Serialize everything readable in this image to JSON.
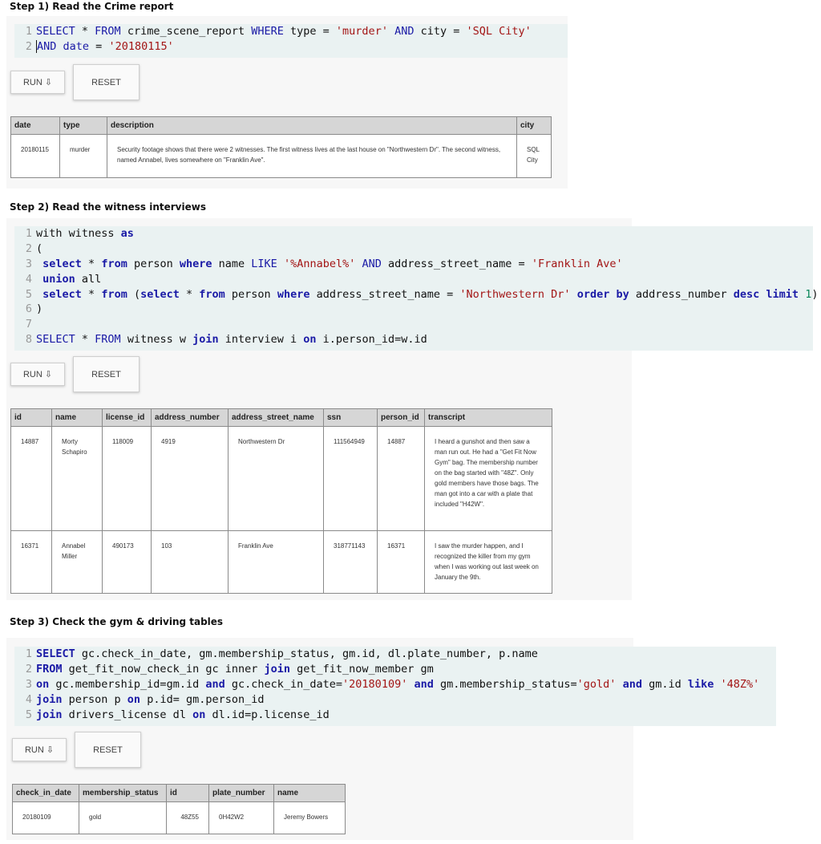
{
  "step1": {
    "title": "Step 1) Read the Crime report",
    "run_label": "RUN ⇩",
    "reset_label": "RESET",
    "columns": [
      "date",
      "type",
      "description",
      "city"
    ],
    "rows": [
      [
        "20180115",
        "murder",
        "Security footage shows that there were 2 witnesses. The first witness lives at the last house on \"Northwestern Dr\". The second witness, named Annabel, lives somewhere on \"Franklin Ave\".",
        "SQL City"
      ]
    ]
  },
  "step2": {
    "title": "Step 2) Read the witness interviews",
    "run_label": "RUN ⇩",
    "reset_label": "RESET",
    "columns": [
      "id",
      "name",
      "license_id",
      "address_number",
      "address_street_name",
      "ssn",
      "person_id",
      "transcript"
    ],
    "rows": [
      [
        "14887",
        "Morty Schapiro",
        "118009",
        "4919",
        "Northwestern Dr",
        "111564949",
        "14887",
        "I heard a gunshot and then saw a man run out. He had a \"Get Fit Now Gym\" bag. The membership number on the bag started with \"48Z\". Only gold members have those bags. The man got into a car with a plate that included \"H42W\"."
      ],
      [
        "16371",
        "Annabel Miller",
        "490173",
        "103",
        "Franklin Ave",
        "318771143",
        "16371",
        "I saw the murder happen, and I recognized the killer from my gym when I was working out last week on January the 9th."
      ]
    ]
  },
  "step3": {
    "title": "Step 3) Check the gym & driving tables",
    "run_label": "RUN ⇩",
    "reset_label": "RESET",
    "columns": [
      "check_in_date",
      "membership_status",
      "id",
      "plate_number",
      "name"
    ],
    "rows": [
      [
        "20180109",
        "gold",
        "48Z55",
        "0H42W2",
        "Jeremy Bowers"
      ]
    ]
  }
}
